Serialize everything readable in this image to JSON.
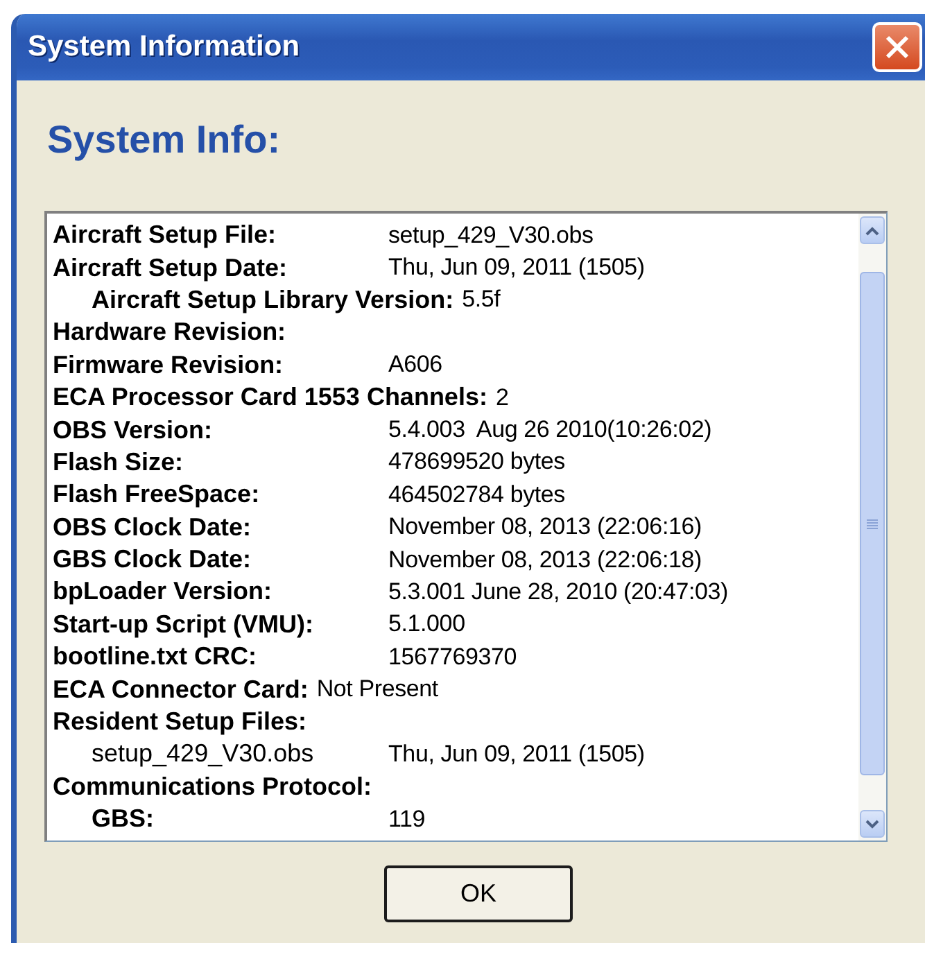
{
  "window": {
    "title": "System Information"
  },
  "heading": "System Info:",
  "rows": [
    {
      "kind": "column",
      "label": "Aircraft Setup File:",
      "value": "setup_429_V30.obs"
    },
    {
      "kind": "column",
      "label": "Aircraft Setup Date:",
      "value": "Thu, Jun 09, 2011 (1505)",
      "children": [
        {
          "kind": "inline",
          "label": "Aircraft Setup Library Version:",
          "value": "5.5f"
        }
      ]
    },
    {
      "kind": "column",
      "label": "Hardware Revision:"
    },
    {
      "kind": "column",
      "label": "Firmware Revision:",
      "value": "A606"
    },
    {
      "kind": "inline",
      "label": "ECA Processor Card 1553 Channels:",
      "value": "2"
    },
    {
      "kind": "column",
      "label": "OBS Version:",
      "value": "5.4.003  Aug 26 2010(10:26:02)"
    },
    {
      "kind": "column",
      "label": "Flash Size:",
      "value": "478699520 bytes"
    },
    {
      "kind": "column",
      "label": "Flash FreeSpace:",
      "value": "464502784 bytes"
    },
    {
      "kind": "column",
      "label": "OBS Clock Date:",
      "value": "November 08, 2013 (22:06:16)"
    },
    {
      "kind": "column",
      "label": "GBS Clock Date:",
      "value": "November 08, 2013 (22:06:18)"
    },
    {
      "kind": "column",
      "label": "bpLoader Version:",
      "value": "5.3.001 June 28, 2010 (20:47:03)"
    },
    {
      "kind": "column",
      "label": "Start-up Script (VMU):",
      "value": "5.1.000"
    },
    {
      "kind": "column",
      "label": "bootline.txt CRC:",
      "value": "1567769370"
    },
    {
      "kind": "inline",
      "label": "ECA Connector Card:",
      "value": "Not Present"
    },
    {
      "kind": "column",
      "label": "Resident Setup Files:",
      "children": [
        {
          "kind": "file",
          "label": "setup_429_V30.obs",
          "value": "Thu, Jun 09, 2011 (1505)"
        }
      ]
    },
    {
      "kind": "column",
      "label": "Communications Protocol:",
      "children": [
        {
          "kind": "column",
          "label": "GBS:",
          "value": "119"
        }
      ]
    }
  ],
  "buttons": [
    "OK"
  ]
}
